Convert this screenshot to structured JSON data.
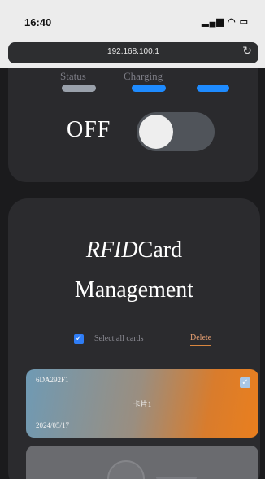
{
  "status_bar": {
    "time": "16:40",
    "system_icons": "signal-wifi-battery"
  },
  "browser": {
    "url": "192.168.100.1",
    "reload_icon": "reload-icon"
  },
  "top_panel": {
    "labels": [
      "Status",
      "Charging"
    ],
    "indicator_colors": [
      "#9aa1ab",
      "#1e8bff",
      "#1e8bff"
    ],
    "power_label": "OFF",
    "power_toggle_on": false
  },
  "rfid_panel": {
    "title_italic": "RFID",
    "title_rest": "Card",
    "title_line2": "Management",
    "select_all_label": "Select all cards",
    "select_all_checked": true,
    "delete_label": "Delete",
    "cards": [
      {
        "uid": "6DA292F1",
        "name": "卡片1",
        "date": "2024/05/17",
        "checked": true
      }
    ]
  }
}
